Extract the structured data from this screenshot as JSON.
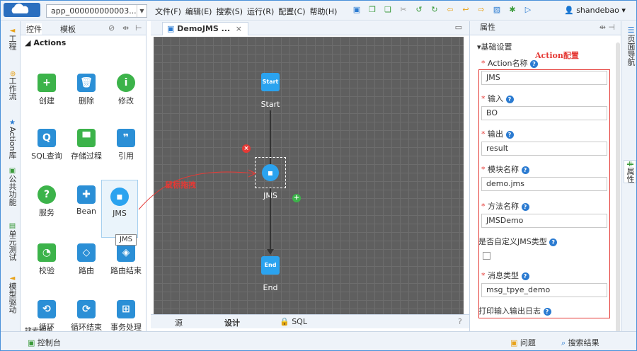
{
  "topbar": {
    "project": "app_000000000003...",
    "menu": [
      "文件(F)",
      "编辑(E)",
      "搜索(S)",
      "运行(R)",
      "配置(C)",
      "帮助(H)"
    ],
    "user": "shandebao"
  },
  "left_strip": {
    "tabs": [
      "工程",
      "工作流",
      "Action库",
      "公共功能",
      "单元测试",
      "模型驱动"
    ]
  },
  "left_panel": {
    "tabs": [
      "控件",
      "模板"
    ],
    "section": "Actions",
    "tiles": [
      "创建",
      "删除",
      "修改",
      "SQL查询",
      "存储过程",
      "引用",
      "服务",
      "Bean",
      "JMS",
      "校验",
      "路由",
      "路由结束",
      "循环",
      "循环结束",
      "事务处理"
    ],
    "tooltip": "JMS",
    "search_results_tab": "搜索结果"
  },
  "editor": {
    "tab_title": "DemoJMS ...",
    "nodes": {
      "start_icon": "Start",
      "start_label": "Start",
      "jms_label": "JMS",
      "end_icon": "End",
      "end_label": "End"
    },
    "annotation_drag": "鼠标拖拽",
    "bottom_tabs": [
      "源",
      "设计",
      "SQL"
    ]
  },
  "properties": {
    "header": "属性",
    "section": "基础设置",
    "annotation": "Action配置",
    "fields": {
      "action_name": {
        "label": "Action名称",
        "value": "JMS"
      },
      "input": {
        "label": "输入",
        "value": "BO"
      },
      "output": {
        "label": "输出",
        "value": "result"
      },
      "module_name": {
        "label": "模块名称",
        "value": "demo.jms"
      },
      "method_name": {
        "label": "方法名称",
        "value": "JMSDemo"
      },
      "custom_jms": {
        "label": "是否自定义JMS类型"
      },
      "msg_type": {
        "label": "消息类型",
        "value": "msg_tpye_demo"
      },
      "print_log": {
        "label": "打印输入输出日志"
      }
    }
  },
  "right_strip": {
    "tabs": [
      "页面导航",
      "属性"
    ]
  },
  "statusbar": {
    "console": "控制台",
    "problems": "问题",
    "search_results": "搜索结果"
  },
  "colors": {
    "accent": "#2ba3ef",
    "annotation": "#e53935",
    "canvas": "#5f5f5f"
  }
}
